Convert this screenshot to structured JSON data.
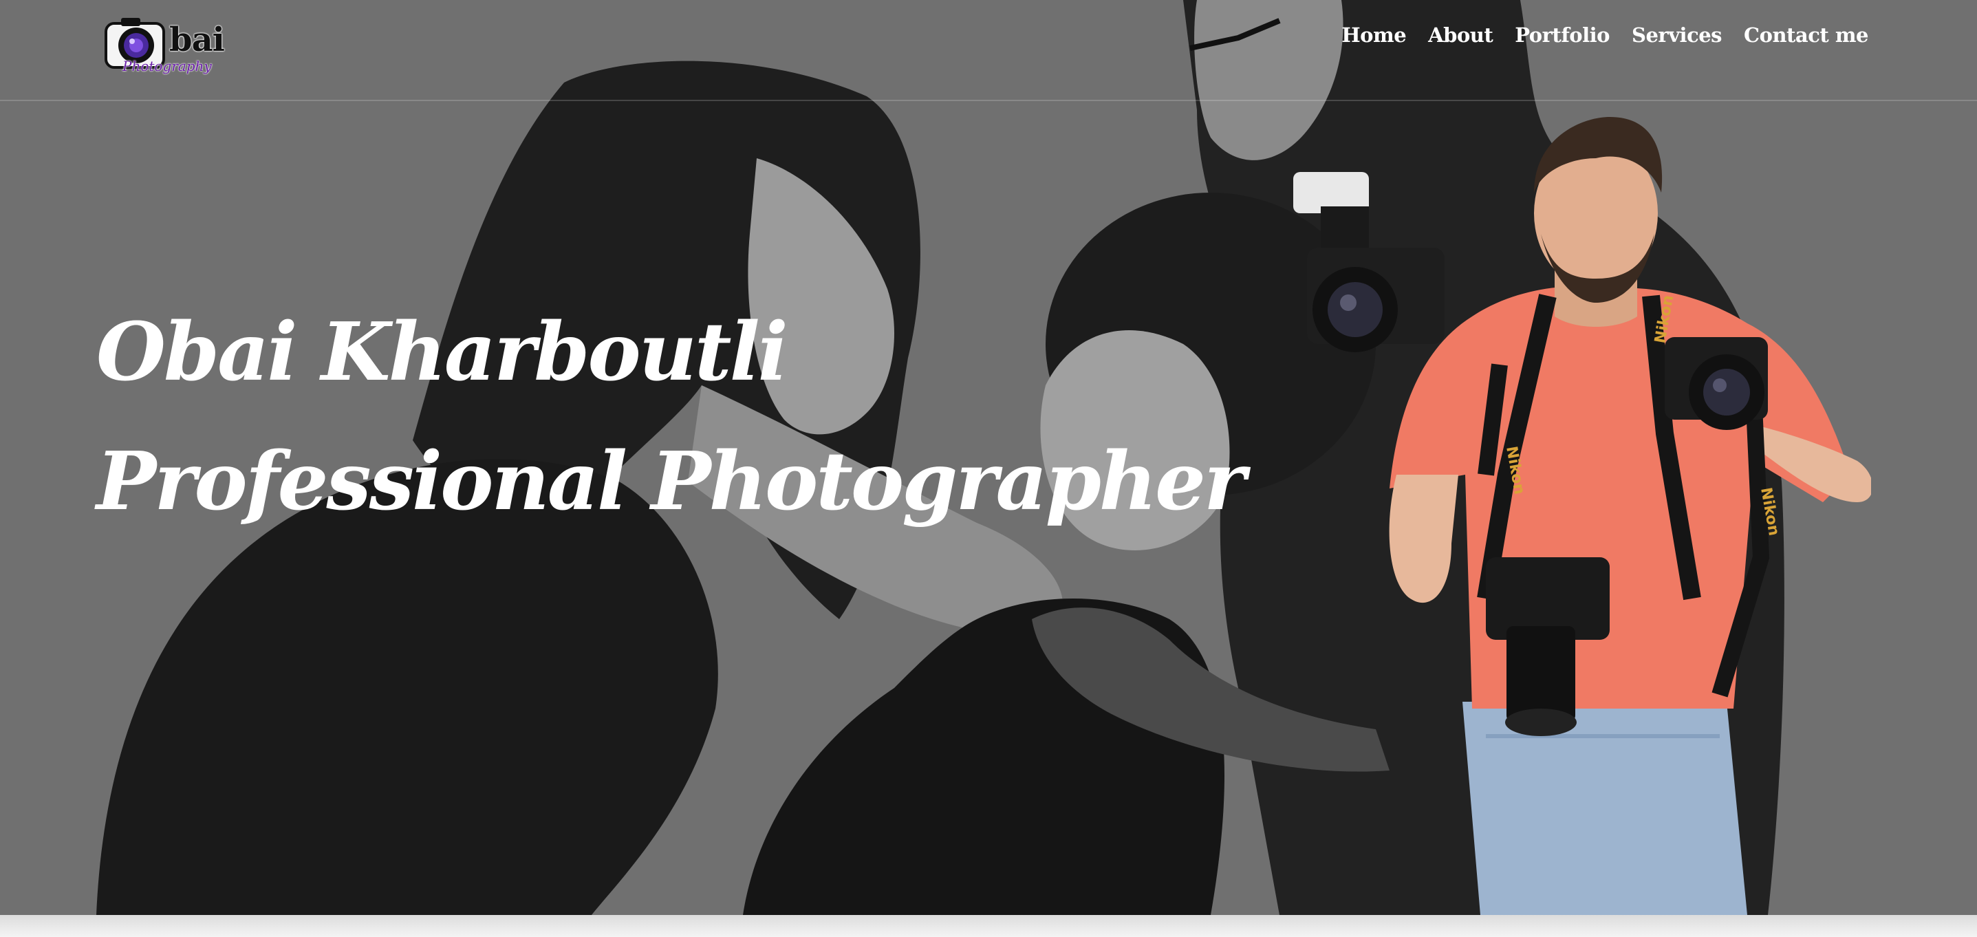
{
  "logo": {
    "word": "bai",
    "subtitle": "Photography"
  },
  "nav": {
    "items": [
      {
        "label": "Home"
      },
      {
        "label": "About"
      },
      {
        "label": "Portfolio"
      },
      {
        "label": "Services"
      },
      {
        "label": "Contact me"
      }
    ]
  },
  "hero": {
    "title_line1": "Obai Kharboutli",
    "title_line2": "Professional Photographer"
  },
  "camera_strap_text": "Nikon",
  "colors": {
    "overlay_gray": "#6e6e6e",
    "shirt": "#f07a64",
    "jeans": "#9db4cf",
    "logo_accent": "#6a1fa8",
    "text": "#ffffff"
  }
}
